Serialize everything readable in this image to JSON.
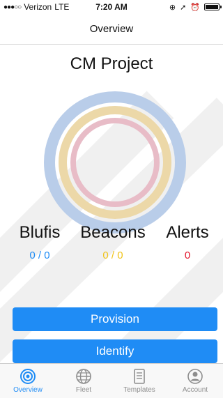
{
  "status_bar": {
    "carrier": "Verizon",
    "network": "LTE",
    "time": "7:20 AM"
  },
  "nav": {
    "title": "Overview"
  },
  "project": {
    "name": "CM Project"
  },
  "colors": {
    "accent": "#1f8cf5",
    "blufis": "#1f8cf5",
    "beacons": "#f0c41a",
    "alerts": "#e3152b",
    "ring_outer": "#b9cde9",
    "ring_mid": "#ecd8a8",
    "ring_inner": "#e8bcc7"
  },
  "stats": {
    "blufis": {
      "label": "Blufis",
      "value": "0 / 0"
    },
    "beacons": {
      "label": "Beacons",
      "value": "0 / 0"
    },
    "alerts": {
      "label": "Alerts",
      "value": "0"
    }
  },
  "actions": {
    "provision": "Provision",
    "identify": "Identify"
  },
  "tabs": [
    {
      "label": "Overview",
      "icon": "target-icon"
    },
    {
      "label": "Fleet",
      "icon": "globe-icon"
    },
    {
      "label": "Templates",
      "icon": "document-icon"
    },
    {
      "label": "Account",
      "icon": "person-icon"
    }
  ]
}
